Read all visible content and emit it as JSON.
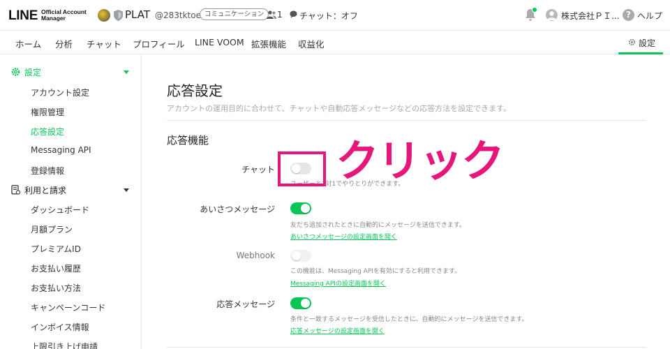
{
  "header": {
    "logo_main": "LINE",
    "logo_sub": "Official Account\nManager",
    "account_name": "PLAT",
    "account_id": "@283tktoe",
    "category": "コミュニケーション",
    "friends_count": "1",
    "chat_status": "チャット：オフ",
    "user_name": "株式会社ＰＩ...",
    "help_label": "ヘルプ"
  },
  "nav": {
    "items": [
      "ホーム",
      "分析",
      "チャット",
      "プロフィール",
      "LINE VOOM",
      "拡張機能",
      "収益化"
    ],
    "settings_label": "設定"
  },
  "sidebar": {
    "settings_group": "設定",
    "settings_items": [
      "アカウント設定",
      "権限管理",
      "応答設定",
      "Messaging API",
      "登録情報"
    ],
    "billing_group": "利用と請求",
    "billing_items": [
      "ダッシュボード",
      "月額プラン",
      "プレミアムID",
      "お支払い履歴",
      "お支払い方法",
      "キャンペーンコード",
      "インボイス情報",
      "上限引き上げ申請"
    ]
  },
  "main": {
    "title": "応答設定",
    "description": "アカウントの運用目的に合わせて、チャットや自動応答メッセージなどの応答方法を設定できます。",
    "section_title": "応答機能",
    "rows": [
      {
        "label": "チャット",
        "state": "off",
        "help": "ユーザーと1対1でやりとりができます。",
        "link": ""
      },
      {
        "label": "あいさつメッセージ",
        "state": "on",
        "help": "友だち追加されたときに自動的にメッセージを送信できます。",
        "link": "あいさつメッセージの設定画面を開く"
      },
      {
        "label": "Webhook",
        "state": "disabled",
        "help": "この機能は、Messaging APIを有効にすると利用できます。",
        "link": "Messaging APIの設定画面を開く"
      },
      {
        "label": "応答メッセージ",
        "state": "on",
        "help": "条件と一致するメッセージを受信したときに、自動的にメッセージを送信できます。",
        "link": "応答メッセージの設定画面を開く"
      }
    ]
  },
  "annotation": {
    "text": "クリック",
    "color": "#e6177b"
  },
  "colors": {
    "accent": "#06c755"
  }
}
